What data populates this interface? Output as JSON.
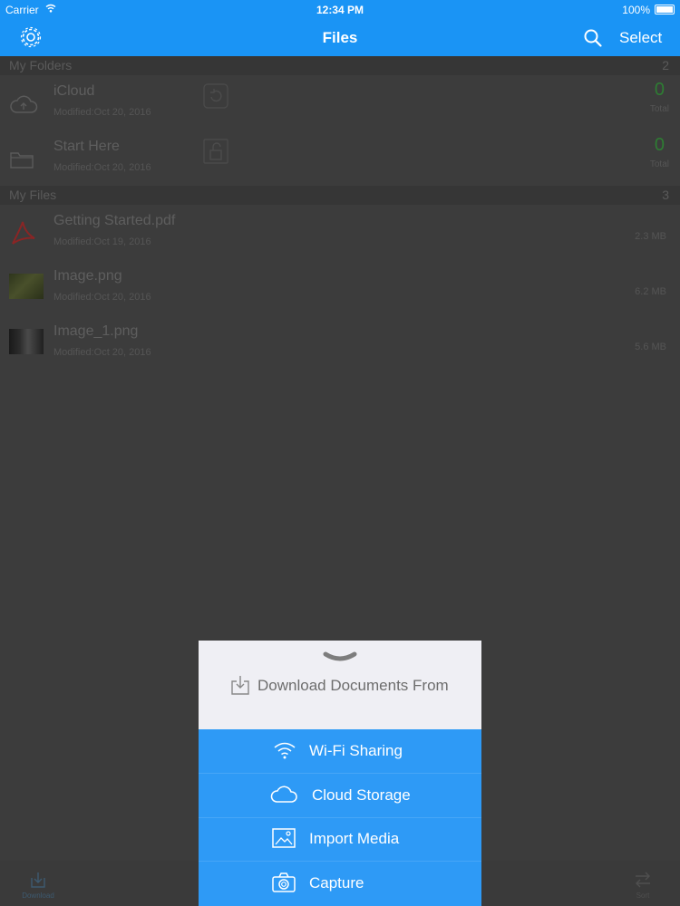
{
  "status": {
    "carrier": "Carrier",
    "time": "12:34 PM",
    "battery": "100%"
  },
  "nav": {
    "title": "Files",
    "select_label": "Select"
  },
  "folders": {
    "header": "My Folders",
    "count": "2",
    "items": [
      {
        "name": "iCloud",
        "modified": "Modified:Oct 20, 2016",
        "count": "0",
        "total_label": "Total"
      },
      {
        "name": "Start Here",
        "modified": "Modified:Oct 20, 2016",
        "count": "0",
        "total_label": "Total"
      }
    ]
  },
  "files": {
    "header": "My Files",
    "count": "3",
    "items": [
      {
        "name": "Getting Started.pdf",
        "modified": "Modified:Oct 19, 2016",
        "size": "2.3 MB",
        "icon": "pdf-icon"
      },
      {
        "name": "Image.png",
        "modified": "Modified:Oct 20, 2016",
        "size": "6.2 MB",
        "icon": "image-thumbnail"
      },
      {
        "name": "Image_1.png",
        "modified": "Modified:Oct 20, 2016",
        "size": "5.6 MB",
        "icon": "image-thumbnail"
      }
    ]
  },
  "tabbar": {
    "download_label": "Download",
    "sort_label": "Sort"
  },
  "sheet": {
    "title": "Download Documents From",
    "options": [
      {
        "label": "Wi-Fi Sharing",
        "icon": "wifi-icon"
      },
      {
        "label": "Cloud Storage",
        "icon": "cloud-icon"
      },
      {
        "label": "Import Media",
        "icon": "image-icon"
      },
      {
        "label": "Capture",
        "icon": "camera-icon"
      }
    ]
  },
  "colors": {
    "accent": "#1a94f5",
    "sheet_blue": "#2e9af6",
    "count_green": "#2e7d33",
    "overlay_bg": "#3c3c3c"
  }
}
